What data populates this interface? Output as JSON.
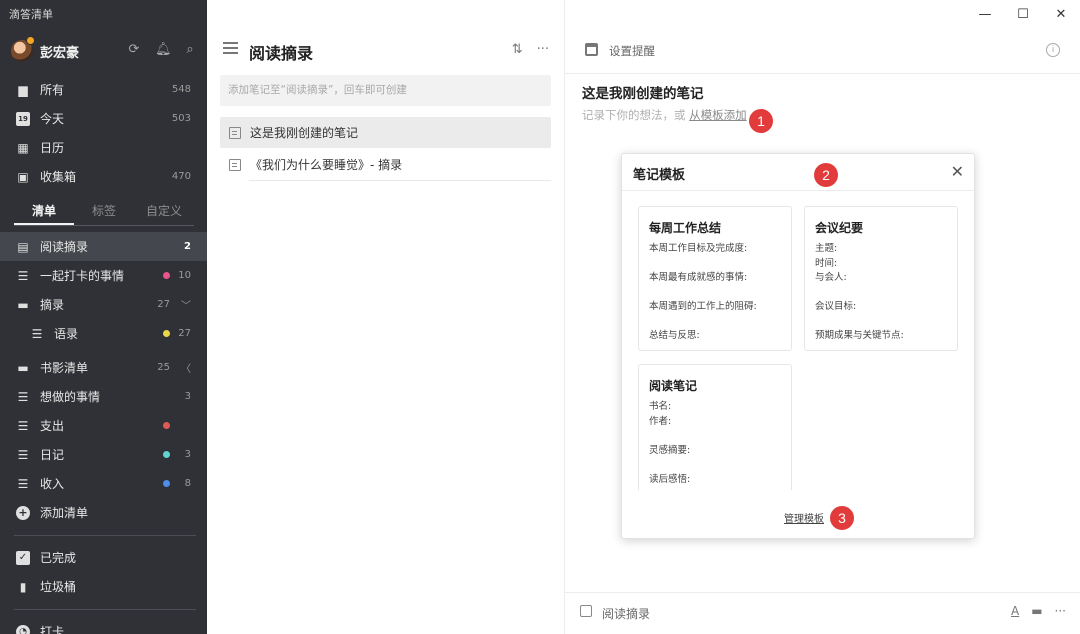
{
  "app_title": "滴答清单",
  "user": {
    "name": "彭宏豪"
  },
  "sidebar": {
    "smart_lists": [
      {
        "label": "所有",
        "count": "548",
        "icon": "inbox-tray-icon"
      },
      {
        "label": "今天",
        "count": "503",
        "icon": "calendar-19-icon",
        "icon_text": "19"
      },
      {
        "label": "日历",
        "count": "",
        "icon": "calendar-grid-icon"
      },
      {
        "label": "收集箱",
        "count": "470",
        "icon": "collection-box-icon"
      }
    ],
    "tabs": [
      "清单",
      "标签",
      "自定义"
    ],
    "lists": [
      {
        "label": "阅读摘录",
        "count": "2",
        "active": true
      },
      {
        "label": "一起打卡的事情",
        "count": "10",
        "dot": "#e8558a"
      },
      {
        "label": "摘录",
        "count": "27",
        "folder": true,
        "chevron": "﹀"
      },
      {
        "label": "语录",
        "count": "27",
        "dot": "#e9d84a",
        "sub": true
      },
      {
        "label": "书影清单",
        "count": "25",
        "folder": true,
        "chevron": "〈"
      },
      {
        "label": "想做的事情",
        "count": "3"
      },
      {
        "label": "支出",
        "count": "",
        "dot": "#e05a55"
      },
      {
        "label": "日记",
        "count": "3",
        "dot": "#5fd4d0"
      },
      {
        "label": "收入",
        "count": "8",
        "dot": "#4f8ee8"
      }
    ],
    "add_list": "添加清单",
    "bottom": [
      {
        "label": "已完成"
      },
      {
        "label": "垃圾桶"
      },
      {
        "label": "打卡"
      }
    ]
  },
  "middle": {
    "title": "阅读摘录",
    "add_placeholder": "添加笔记至“阅读摘录”，回车即可创建",
    "notes": [
      "这是我刚创建的笔记",
      "《我们为什么要睡觉》- 摘录"
    ]
  },
  "right": {
    "remind_label": "设置提醒",
    "note_title": "这是我刚创建的笔记",
    "hint_prefix": "记录下你的想法，或 ",
    "hint_link": "从模板添加",
    "footer_list": "阅读摘录",
    "footer_tools": [
      "A",
      "▬",
      "···"
    ]
  },
  "modal": {
    "title": "笔记模板",
    "templates": [
      {
        "title": "每周工作总结",
        "lines": [
          "本周工作目标及完成度:",
          "本周最有成就感的事情:",
          "本周遇到的工作上的阻碍:",
          "总结与反思:"
        ]
      },
      {
        "title": "会议纪要",
        "lines": [
          "主题:",
          "时间:",
          "与会人:",
          "会议目标:",
          "预期成果与关键节点:"
        ]
      },
      {
        "title": "阅读笔记",
        "lines": [
          "书名:",
          "作者:",
          "灵感摘要:",
          "读后感悟:"
        ]
      }
    ],
    "manage": "管理模板"
  },
  "badges": [
    "1",
    "2",
    "3"
  ]
}
